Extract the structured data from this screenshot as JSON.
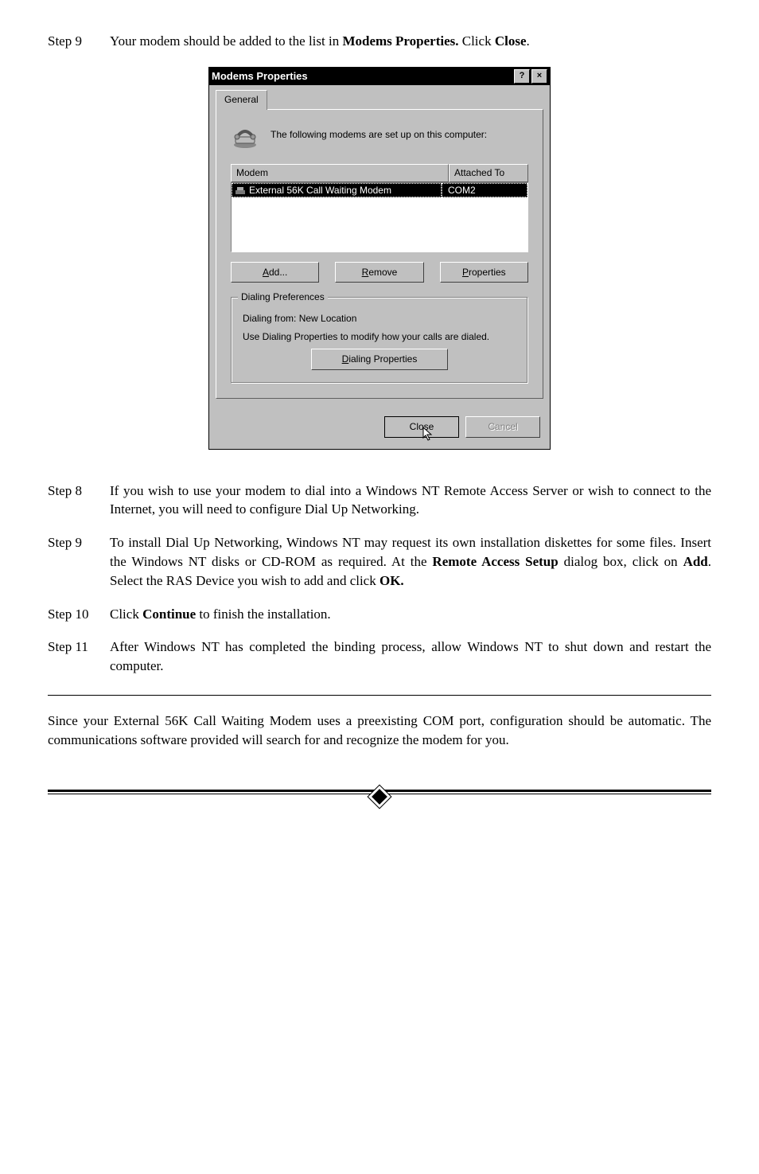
{
  "step9a": {
    "label": "Step 9",
    "text_pre": "Your modem should be added to the list in ",
    "bold1": "Modems Properties.",
    "text_mid": " Click ",
    "bold2": "Close",
    "text_post": "."
  },
  "dialog": {
    "title": "Modems Properties",
    "help": "?",
    "close": "×",
    "tab": "General",
    "intro": "The following modems are set up on this computer:",
    "col_modem": "Modem",
    "col_attached": "Attached To",
    "row_modem": "External 56K Call Waiting Modem",
    "row_port": "COM2",
    "btn_add": "Add...",
    "btn_add_ul": "A",
    "btn_remove": "Remove",
    "btn_remove_ul": "R",
    "btn_props": "Properties",
    "btn_props_ul": "P",
    "group_title": "Dialing Preferences",
    "dialing_from": "Dialing from:  New Location",
    "dialing_desc": "Use Dialing Properties to modify how your calls are dialed.",
    "btn_dialing": "Dialing Properties",
    "btn_dialing_ul": "D",
    "footer_close": "Close",
    "footer_cancel": "Cancel"
  },
  "step8": {
    "label": "Step 8",
    "text": "If you wish to use your modem to dial into a Windows NT Remote Access Server or wish to connect to the Internet, you will need to configure Dial Up Networking."
  },
  "step9b": {
    "label": "Step 9",
    "t1": "To install Dial Up Networking, Windows NT may request its own installation diskettes for some files. Insert the Windows NT disks or CD-ROM as required. At the ",
    "b1": "Remote Access Setup",
    "t2": " dialog box, click on ",
    "b2": "Add",
    "t3": ". Select the RAS Device you wish to add and click ",
    "b3": "OK.",
    "t4": ""
  },
  "step10": {
    "label": "Step 10",
    "t1": "Click ",
    "b1": "Continue",
    "t2": " to finish the installation."
  },
  "step11": {
    "label": "Step 11",
    "text": "After Windows NT has completed the binding process, allow Windows NT to shut down and restart the computer."
  },
  "closing": "Since your External 56K Call Waiting Modem uses a preexisting COM port, configuration should be automatic. The communications software provided will search for and recognize the modem for you."
}
